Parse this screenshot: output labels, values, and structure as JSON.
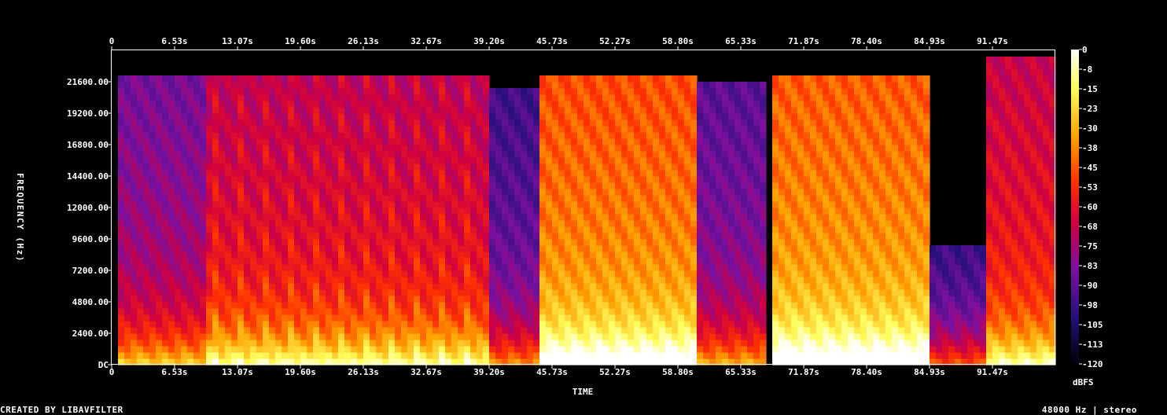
{
  "chart_data": {
    "type": "heatmap",
    "title": "",
    "xlabel": "TIME",
    "ylabel": "FREQUENCY (Hz)",
    "x_ticks": [
      "0",
      "6.53s",
      "13.07s",
      "19.60s",
      "26.13s",
      "32.67s",
      "39.20s",
      "45.73s",
      "52.27s",
      "58.80s",
      "65.33s",
      "71.87s",
      "78.40s",
      "84.93s",
      "91.47s"
    ],
    "x_tick_values": [
      0,
      6.53,
      13.07,
      19.6,
      26.13,
      32.67,
      39.2,
      45.73,
      52.27,
      58.8,
      65.33,
      71.87,
      78.4,
      84.93,
      91.47
    ],
    "xlim": [
      0,
      98
    ],
    "y_ticks": [
      "DC",
      "2400.00",
      "4800.00",
      "7200.00",
      "9600.00",
      "12000.00",
      "14400.00",
      "16800.00",
      "19200.00",
      "21600.00"
    ],
    "y_tick_values": [
      0,
      2400,
      4800,
      7200,
      9600,
      12000,
      14400,
      16800,
      19200,
      21600
    ],
    "ylim": [
      0,
      24000
    ],
    "colorbar": {
      "label": "dBFS",
      "ticks": [
        "0",
        "-8",
        "-15",
        "-23",
        "-30",
        "-38",
        "-45",
        "-53",
        "-60",
        "-68",
        "-75",
        "-83",
        "-90",
        "-98",
        "-105",
        "-113",
        "-120"
      ],
      "range": [
        -120,
        0
      ]
    },
    "segments": [
      {
        "start": 0.5,
        "end": 9.5,
        "level": 0.4,
        "cutoff": 22000,
        "stripes": false
      },
      {
        "start": 9.5,
        "end": 39.2,
        "level": 0.52,
        "cutoff": 22000,
        "stripes": true
      },
      {
        "start": 39.2,
        "end": 44.5,
        "level": 0.3,
        "cutoff": 21000,
        "stripes": false
      },
      {
        "start": 44.5,
        "end": 60.5,
        "level": 0.72,
        "cutoff": 22000,
        "stripes": false
      },
      {
        "start": 60.5,
        "end": 68.0,
        "level": 0.35,
        "cutoff": 21500,
        "stripes": false
      },
      {
        "start": 68.5,
        "end": 85.0,
        "level": 0.74,
        "cutoff": 22000,
        "stripes": false
      },
      {
        "start": 85.0,
        "end": 91.0,
        "level": 0.22,
        "cutoff": 9000,
        "stripes": false
      },
      {
        "start": 91.0,
        "end": 98.0,
        "level": 0.55,
        "cutoff": 23500,
        "stripes": false
      }
    ]
  },
  "footer": {
    "left": "CREATED BY LIBAVFILTER",
    "right": "48000 Hz | stereo"
  }
}
